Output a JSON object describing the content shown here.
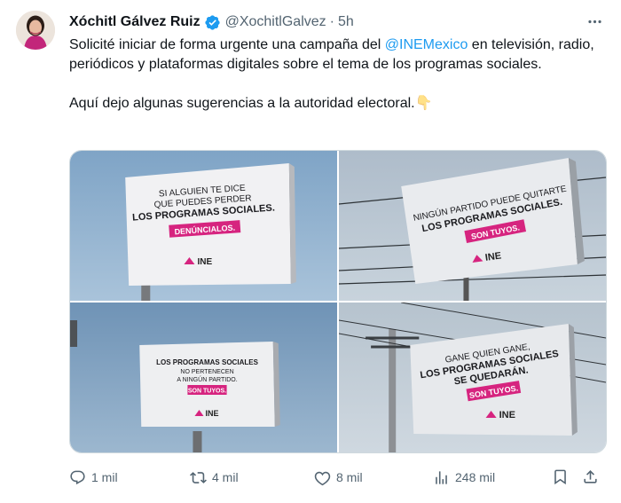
{
  "tweet": {
    "author_name": "Xóchitl Gálvez Ruiz",
    "author_handle": "@XochitlGalvez",
    "separator": "·",
    "time": "5h",
    "text_intro": "Solicité iniciar de forma urgente una campaña del ",
    "mention": "@INEMexico",
    "text_rest": " en televisión, radio, periódicos y plataformas digitales sobre el tema de los programas sociales.",
    "text_para2": "Aquí dejo algunas sugerencias a la autoridad electoral.",
    "emoji": "👇"
  },
  "billboards": [
    {
      "lines": [
        "SI ALGUIEN TE DICE",
        "QUE PUEDES PERDER",
        "LOS PROGRAMAS SOCIALES."
      ],
      "badge": "DENÚNCIALOS.",
      "logo": "INE"
    },
    {
      "lines": [
        "NINGÚN PARTIDO PUEDE QUITARTE",
        "LOS PROGRAMAS SOCIALES."
      ],
      "badge": "SON TUYOS.",
      "logo": "INE"
    },
    {
      "lines": [
        "LOS PROGRAMAS SOCIALES",
        "NO PERTENECEN",
        "A NINGÚN PARTIDO."
      ],
      "badge": "SON TUYOS.",
      "logo": "INE"
    },
    {
      "lines": [
        "GANE QUIEN GANE,",
        "LOS PROGRAMAS SOCIALES",
        "SE QUEDARÁN."
      ],
      "badge": "SON TUYOS.",
      "logo": "INE"
    }
  ],
  "actions": {
    "replies": "1 mil",
    "reposts": "4 mil",
    "likes": "8 mil",
    "views": "248 mil"
  },
  "colors": {
    "accent": "#1d9bf0",
    "muted": "#536471",
    "ine_pink": "#d6247f"
  }
}
